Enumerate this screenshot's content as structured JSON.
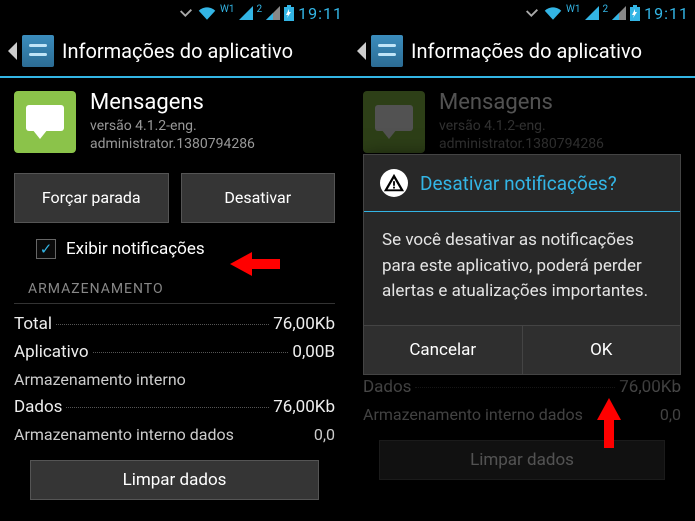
{
  "status": {
    "clock": "19:11",
    "sim1": "W1",
    "sim2": "2"
  },
  "actionbar": {
    "title": "Informações do aplicativo"
  },
  "app": {
    "name": "Mensagens",
    "version_line1": "versão 4.1.2-eng.",
    "version_line2": "administrator.1380794286"
  },
  "buttons": {
    "force_stop": "Forçar parada",
    "disable": "Desativar"
  },
  "checkbox": {
    "label": "Exibir notificações"
  },
  "storage": {
    "section": "ARMAZENAMENTO",
    "total_label": "Total",
    "total_value": "76,00Kb",
    "app_label": "Aplicativo",
    "app_value": "0,00B",
    "internal_label": "Armazenamento interno",
    "data_label": "Dados",
    "data_value": "76,00Kb",
    "internal_data_label": "Armazenamento interno dados",
    "internal_data_value": "0,0",
    "clear": "Limpar dados"
  },
  "dialog": {
    "title": "Desativar notificações?",
    "body": "Se você desativar as notificações para este aplicativo, poderá perder alertas e atualizações importantes.",
    "cancel": "Cancelar",
    "ok": "OK"
  }
}
